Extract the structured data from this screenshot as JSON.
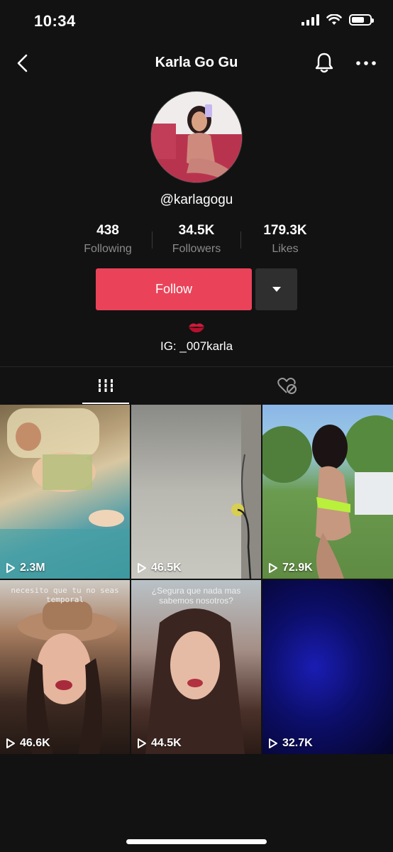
{
  "status_bar": {
    "time": "10:34"
  },
  "header": {
    "title": "Karla Go Gu"
  },
  "profile": {
    "handle": "@karlagogu",
    "stats": [
      {
        "value": "438",
        "label": "Following"
      },
      {
        "value": "34.5K",
        "label": "Followers"
      },
      {
        "value": "179.3K",
        "label": "Likes"
      }
    ],
    "follow_label": "Follow",
    "bio_emoji": "💋",
    "bio": "IG: _007karla"
  },
  "tabs": [
    {
      "icon": "grid-icon",
      "active": true
    },
    {
      "icon": "liked-hidden-icon",
      "active": false
    }
  ],
  "videos": [
    {
      "views": "2.3M",
      "caption": ""
    },
    {
      "views": "46.5K",
      "caption": ""
    },
    {
      "views": "72.9K",
      "caption": ""
    },
    {
      "views": "46.6K",
      "caption": "necesito que tu no seas temporal"
    },
    {
      "views": "44.5K",
      "caption": "¿Segura que nada mas sabemos nosotros?"
    },
    {
      "views": "32.7K",
      "caption": ""
    }
  ],
  "colors": {
    "follow": "#ea4359",
    "background": "#121212"
  }
}
